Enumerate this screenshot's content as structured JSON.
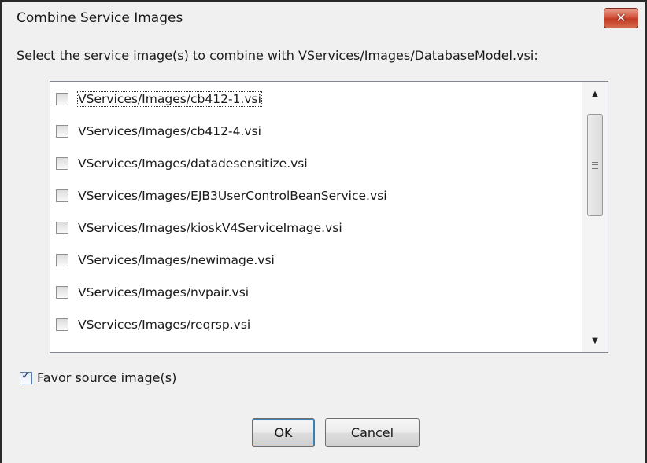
{
  "window": {
    "title": "Combine Service Images",
    "close_symbol": "✕"
  },
  "instruction": "Select the service image(s) to combine with VServices/Images/DatabaseModel.vsi:",
  "list": {
    "items": [
      {
        "label": "VServices/Images/cb412-1.vsi",
        "checked": false,
        "focused": true
      },
      {
        "label": "VServices/Images/cb412-4.vsi",
        "checked": false
      },
      {
        "label": "VServices/Images/datadesensitize.vsi",
        "checked": false
      },
      {
        "label": "VServices/Images/EJB3UserControlBeanService.vsi",
        "checked": false
      },
      {
        "label": "VServices/Images/kioskV4ServiceImage.vsi",
        "checked": false
      },
      {
        "label": "VServices/Images/newimage.vsi",
        "checked": false
      },
      {
        "label": "VServices/Images/nvpair.vsi",
        "checked": false
      },
      {
        "label": "VServices/Images/reqrsp.vsi",
        "checked": false
      }
    ],
    "scroll_up_symbol": "▲",
    "scroll_down_symbol": "▼"
  },
  "favor_source": {
    "label": "Favor source image(s)",
    "checked": true,
    "check_symbol": "✓"
  },
  "buttons": {
    "ok_label": "OK",
    "cancel_label": "Cancel"
  }
}
